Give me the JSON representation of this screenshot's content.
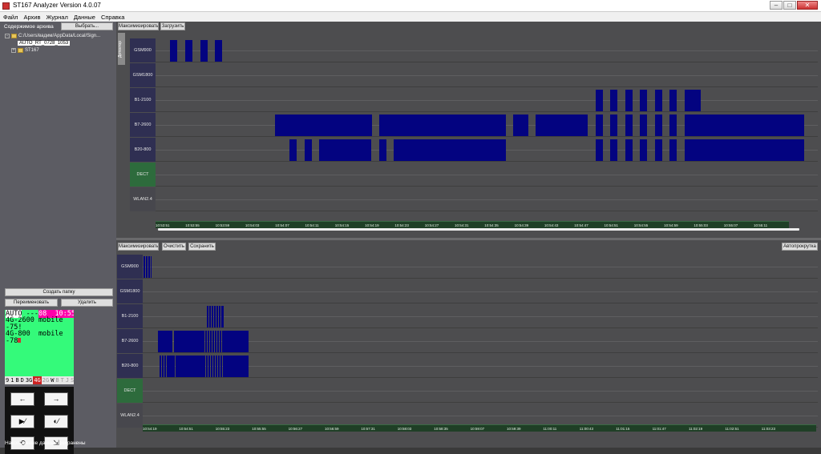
{
  "window": {
    "title": "ST167 Analyzer Version 4.0.07",
    "minimize": "–",
    "maximize": "□",
    "close": "✕"
  },
  "menu": [
    "Файл",
    "Архив",
    "Журнал",
    "Данные",
    "Справка"
  ],
  "left": {
    "archive_label": "Содержимое архива",
    "choose_button": "Выбрать...",
    "tree": {
      "path": "C:/Users/вадим/AppData/Local/Sign...",
      "selected": "AUTO_RT_0728_1053",
      "folder": "ST167"
    },
    "create_folder_button": "Создать папку",
    "rename_button": "Переименовать",
    "delete_button": "Удалить",
    "lcd": {
      "auto": "AUTO",
      "dashes": " ---",
      "time": "08  10:55",
      "line2": "4G-2600 mobile",
      "line3": "-75!",
      "line4": "4G-800  mobile",
      "line5": "-78",
      "status": [
        "9",
        "1",
        "B",
        "D",
        "3G",
        "4G",
        "2G",
        "W",
        "B",
        "T",
        "J",
        "S"
      ]
    },
    "keys": [
      "←",
      "→",
      "▶⁄",
      "◐⁄",
      "⟲",
      "⇲"
    ],
    "status_text": "Накопленные данные сохранены"
  },
  "top": {
    "maximize_button": "Максимизировать",
    "load_button": "Загрузить",
    "side_tab": "Детектор",
    "rows": [
      "GSM900",
      "GSM1800",
      "B1-2100",
      "B7-2600",
      "B20-800",
      "DECT",
      "WLAN2.4"
    ],
    "ticks": [
      "10:53:51",
      "10:53:55",
      "10:53:59",
      "10:54:03",
      "10:54:07",
      "10:54:11",
      "10:54:15",
      "10:54:19",
      "10:54:23",
      "10:54:27",
      "10:54:31",
      "10:54:35",
      "10:54:39",
      "10:54:43",
      "10:54:47",
      "10:54:51",
      "10:54:55",
      "10:54:59",
      "10:55:03",
      "10:55:07",
      "10:55:11"
    ]
  },
  "bottom": {
    "maximize_button": "Максимизировать",
    "clear_button": "Очистить",
    "save_button": "Сохранить",
    "autoscroll_button": "Автопрокрутка",
    "rows": [
      "GSM900",
      "GSM1800",
      "B1-2100",
      "B7-2600",
      "B20-800",
      "DECT",
      "WLAN2.4"
    ],
    "ticks": [
      "10:54:19",
      "10:54:51",
      "10:55:23",
      "10:55:55",
      "10:56:27",
      "10:56:59",
      "10:57:31",
      "10:58:03",
      "10:58:35",
      "10:59:07",
      "10:59:39",
      "11:00:11",
      "11:00:43",
      "11:01:15",
      "11:01:47",
      "11:02:19",
      "11:02:51",
      "11:03:23"
    ]
  },
  "colors": {
    "bar": "#030380",
    "dect": "#2d6b3c",
    "label": "#2f2f52",
    "lcd": "#34fa7a"
  }
}
